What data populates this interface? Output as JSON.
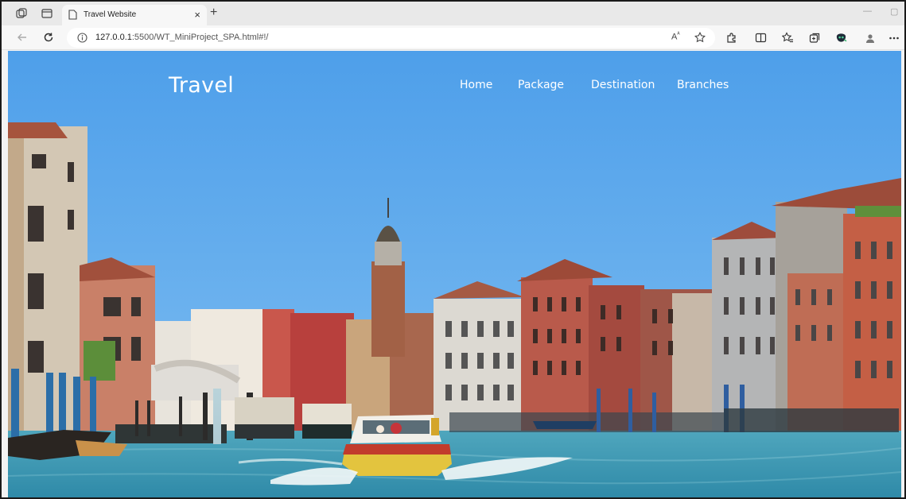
{
  "browser": {
    "tab_title": "Travel Website",
    "new_tab_symbol": "+",
    "close_symbol": "×",
    "url_host": "127.0.0.1",
    "url_rest": ":5500/WT_MiniProject_SPA.html#!/"
  },
  "page": {
    "brand": "Travel",
    "nav": [
      "Home",
      "Package",
      "Destination",
      "Branches"
    ]
  },
  "icons": {
    "tab_actions": "tab-actions-icon",
    "workspaces": "workspaces-icon",
    "page": "page-icon",
    "back": "back-arrow-icon",
    "refresh": "refresh-icon",
    "info": "info-icon",
    "read_aloud": "read-aloud-icon",
    "favorite": "star-icon",
    "extensions": "extensions-icon",
    "split": "split-screen-icon",
    "favorites": "favorites-icon",
    "collections": "collections-icon",
    "copilot": "copilot-icon",
    "profile": "profile-icon",
    "more": "more-icon"
  },
  "colors": {
    "sky": "#5aa6ec",
    "water": "#3c97b5",
    "boat_hull": "#e3c43e",
    "nav_text": "#ffffff"
  }
}
